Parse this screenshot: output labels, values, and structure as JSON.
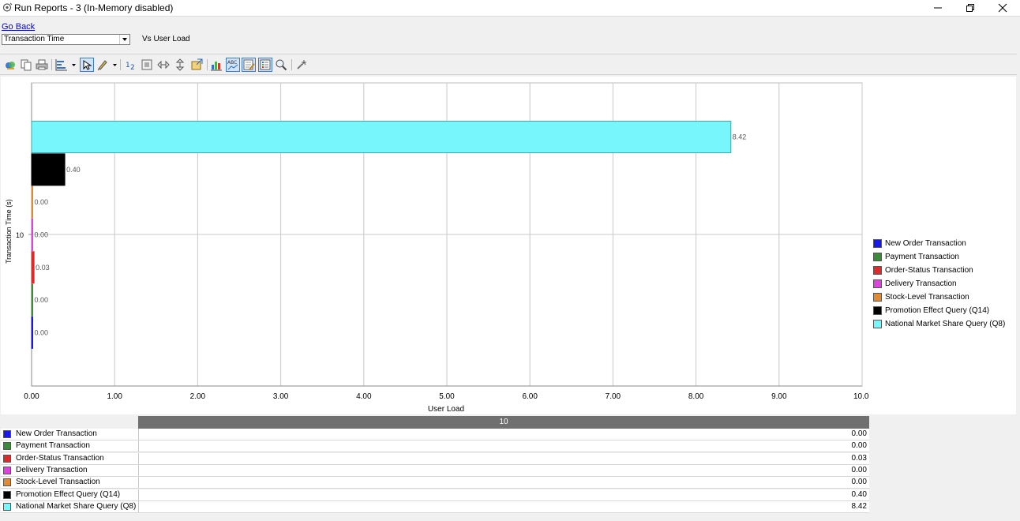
{
  "window": {
    "title": "Run Reports - 3 (In-Memory disabled)",
    "icons": [
      "app-icon",
      "minimize-icon",
      "maximize-icon",
      "close-icon"
    ]
  },
  "controls": {
    "go_back": "Go Back",
    "metric_select_value": "Transaction Time",
    "vs_label": "Vs User Load"
  },
  "toolbar": {
    "icons": [
      "chart-wizard-icon",
      "copy-icon",
      "print-icon",
      "chart-type-icon",
      "selection-arrow-icon",
      "format-icon",
      "data-editor-icon",
      "fit-icon",
      "rotate-horizontal-icon",
      "rotate-vertical-icon",
      "export-icon",
      "gallery-icon",
      "data-labels-icon",
      "edit-icon",
      "legend-icon",
      "zoom-icon",
      "tools-icon"
    ]
  },
  "chart_data": {
    "type": "bar",
    "orientation": "horizontal",
    "xlabel": "User Load",
    "ylabel": "Transaction Time (s)",
    "category": "10",
    "xlim": [
      0,
      10
    ],
    "x_ticks": [
      "0.00",
      "1.00",
      "2.00",
      "3.00",
      "4.00",
      "5.00",
      "6.00",
      "7.00",
      "8.00",
      "9.00",
      "10.00"
    ],
    "grid": true,
    "legend_position": "right",
    "series": [
      {
        "name": "New Order Transaction",
        "value": 0.0,
        "label": "0.00",
        "color": "#1818ee"
      },
      {
        "name": "Payment Transaction",
        "value": 0.0,
        "label": "0.00",
        "color": "#3a8a3a"
      },
      {
        "name": "Order-Status Transaction",
        "value": 0.03,
        "label": "0.03",
        "color": "#dd2b2b"
      },
      {
        "name": "Delivery Transaction",
        "value": 0.0,
        "label": "0.00",
        "color": "#dd44dd"
      },
      {
        "name": "Stock-Level Transaction",
        "value": 0.0,
        "label": "0.00",
        "color": "#e08a33"
      },
      {
        "name": "Promotion Effect Query (Q14)",
        "value": 0.4,
        "label": "0.40",
        "color": "#000000"
      },
      {
        "name": "National Market Share Query (Q8)",
        "value": 8.42,
        "label": "8.42",
        "color": "#77f6fb"
      }
    ]
  },
  "table": {
    "header": "10"
  }
}
